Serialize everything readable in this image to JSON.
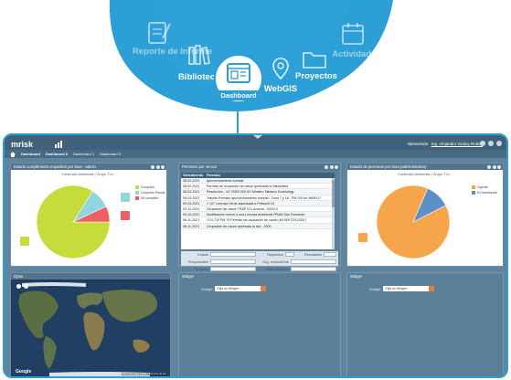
{
  "menu": {
    "items": [
      {
        "label": "Reporte de Informe",
        "icon": "report-icon",
        "state": "faded"
      },
      {
        "label": "Bibliotec",
        "icon": "books-icon",
        "state": "normal"
      },
      {
        "label": "Dashboard",
        "icon": "dashboard-icon",
        "state": "active"
      },
      {
        "label": "WebGIS",
        "icon": "map-pin-icon",
        "state": "normal"
      },
      {
        "label": "Proyectos",
        "icon": "folder-icon",
        "state": "normal"
      },
      {
        "label": "Actividades",
        "icon": "calendar-icon",
        "state": "faded"
      }
    ]
  },
  "colors": {
    "menu_blue": "#2b9fd6",
    "app_bg": "#5e84a0",
    "topbar": "#3f6179",
    "pie_green": "#c6dc3a",
    "pie_cyan": "#8fd6df",
    "pie_red": "#ee5f63",
    "pie_orange": "#f7a54b",
    "pie_blue": "#5b90c9",
    "accent_orange": "#e87b2f"
  },
  "app": {
    "logo": "mrisk",
    "user_text": "Bienvenido",
    "user_name": "Ing. Alejandro Godoy Rodas",
    "breadcrumbs": [
      "Dashboard",
      "Dashboard 0",
      "Dashboard 1",
      "Dashboard 2"
    ]
  },
  "widgets": {
    "pie1": {
      "title": "Estado cumplimiento requisitos por área - admin",
      "subtitle": "Contenido Ambiental | Grupo T m..."
    },
    "table": {
      "title": "Permisos por vencer",
      "col1": "Vencimiento",
      "col2": "Permiso",
      "rows": [
        [
          "08-02-2021",
          "aprovechamiento forestal"
        ],
        [
          "08-02-2021",
          "Permiso de ocupación de cauce quebrada la Sabandina"
        ],
        [
          "08-02-2021",
          "Resolución - 10 73300 000 M.I Ministro Tabasco Ecobiology"
        ],
        [
          "09-03-2021",
          "Trámite Permiso aprovechamiento forestal - Zona 7 y 18 - PM S/S en 08/09/17"
        ],
        [
          "09-03-2021",
          "1 107 Licencia Verde autorizada a Pelissolf 15"
        ],
        [
          "03-10-2021",
          "Ocupación de cauce TRAP 01 Lucrecia - 04/03 0"
        ],
        [
          "09-10-2021",
          "Modificación menor a una Licencia Ambiental PRAM San Fernando"
        ],
        [
          "06-11-2021",
          "17/1 712 PM 79 Permiso de ocupación de cauce (MI 909 22/12/2017"
        ],
        [
          "08-11-2021",
          "Ocupación de cauce quebrada la Isla - 2009"
        ]
      ],
      "form": {
        "estado": "Estado",
        "requisitos": "Requisitos",
        "resultados": "Resultados",
        "responsable": "Responsable",
        "org_emisor": "Org. emisor/Ente",
        "proyecto": "Proyecto",
        "observaciones": "Observaciones"
      }
    },
    "pie2": {
      "title": "Estado de permisos por área (administrativo)",
      "subtitle": "Contenido Ambiental | Grupo T m..."
    },
    "map": {
      "title": "Open",
      "google": "Google",
      "attribution": "Datos del mapa ©2021 | Términos de uso"
    },
    "widget_mid": {
      "title": "Widget",
      "label": "Widget",
      "placeholder": "Elija un Widget"
    },
    "widget_right": {
      "title": "Widget",
      "label": "Widget",
      "placeholder": "Elija un Widget"
    }
  },
  "chart_data": [
    {
      "type": "pie",
      "title": "Contenido Ambiental | Grupo T m...",
      "series": [
        {
          "name": "",
          "values": [
            84,
            9,
            7
          ]
        }
      ],
      "categories": [
        "Cumplido",
        "Cumplido Parcial",
        "No cumplido"
      ],
      "legend": "right"
    },
    {
      "type": "pie",
      "title": "Contenido Ambiental | Grupo T m...",
      "series": [
        {
          "name": "",
          "values": [
            89,
            11
          ]
        }
      ],
      "categories": [
        "Vigente",
        "En tramitación"
      ],
      "legend": "right"
    }
  ]
}
